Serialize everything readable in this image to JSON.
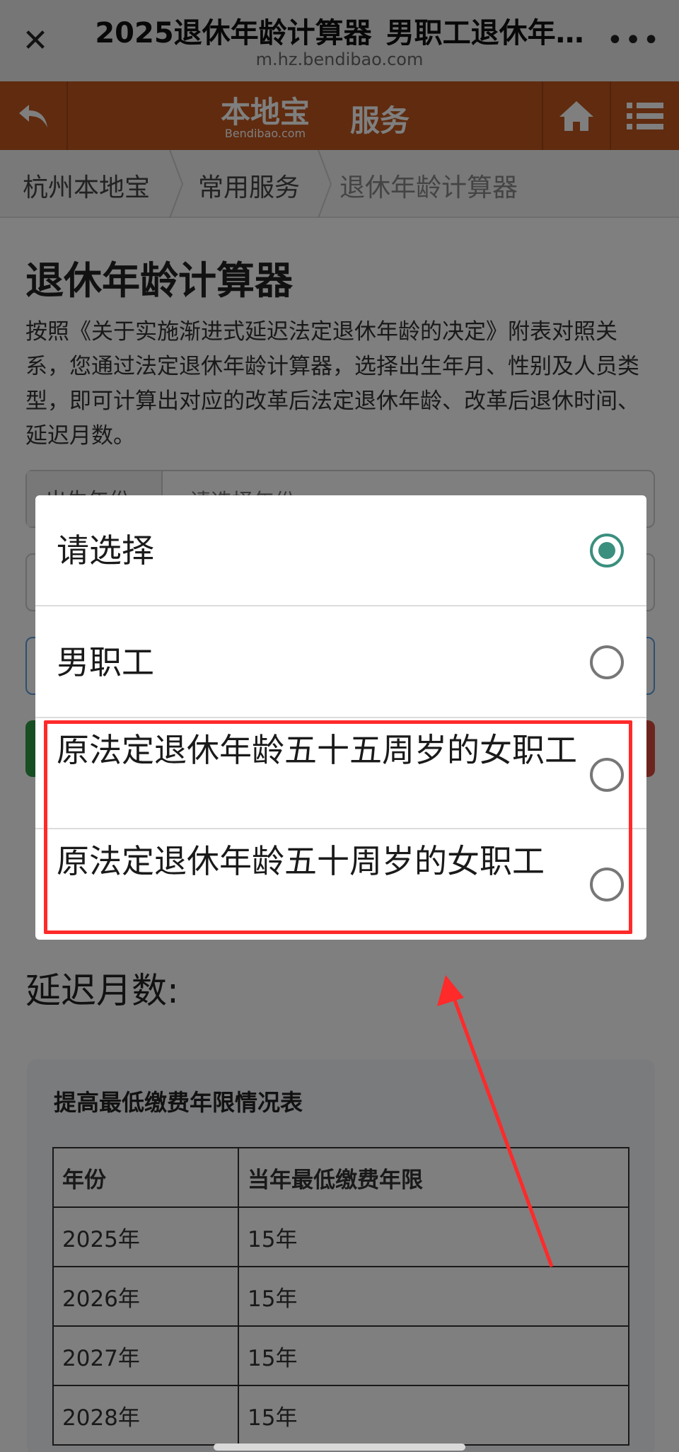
{
  "browser": {
    "title": "2025退休年龄计算器_男职工退休年…",
    "url": "m.hz.bendibao.com",
    "close_icon": "close-icon",
    "more_icon": "more-icon"
  },
  "header": {
    "logo_text": "本地宝",
    "logo_sub": "Bendibao.com",
    "service_label": "服务",
    "back_icon": "back-arrow-icon",
    "home_icon": "home-icon",
    "menu_icon": "menu-icon",
    "color": "#c0571f"
  },
  "breadcrumb": {
    "items": [
      "杭州本地宝",
      "常用服务",
      "退休年龄计算器"
    ]
  },
  "main": {
    "title": "退休年龄计算器",
    "intro": "按照《关于实施渐进式延迟法定退休年龄的决定》附表对照关系，您通过法定退休年龄计算器，选择出生年月、性别及人员类型，即可计算出对应的改革后法定退休年龄、改革后退休时间、延迟月数。",
    "form": {
      "birth_year_label": "出生年份",
      "birth_year_value": "请选择年份"
    },
    "results": {
      "delay_months_label": "延迟月数:"
    }
  },
  "table": {
    "title": "提高最低缴费年限情况表",
    "headers": [
      "年份",
      "当年最低缴费年限"
    ],
    "rows": [
      [
        "2025年",
        "15年"
      ],
      [
        "2026年",
        "15年"
      ],
      [
        "2027年",
        "15年"
      ],
      [
        "2028年",
        "15年"
      ]
    ]
  },
  "picker": {
    "options": [
      {
        "label": "请选择",
        "selected": true
      },
      {
        "label": "男职工",
        "selected": false
      },
      {
        "label": "原法定退休年龄五十五周岁的女职工",
        "selected": false
      },
      {
        "label": "原法定退休年龄五十周岁的女职工",
        "selected": false
      }
    ],
    "accent_color": "#3b8f7e"
  },
  "annotation": {
    "color": "#ff2a2a"
  }
}
